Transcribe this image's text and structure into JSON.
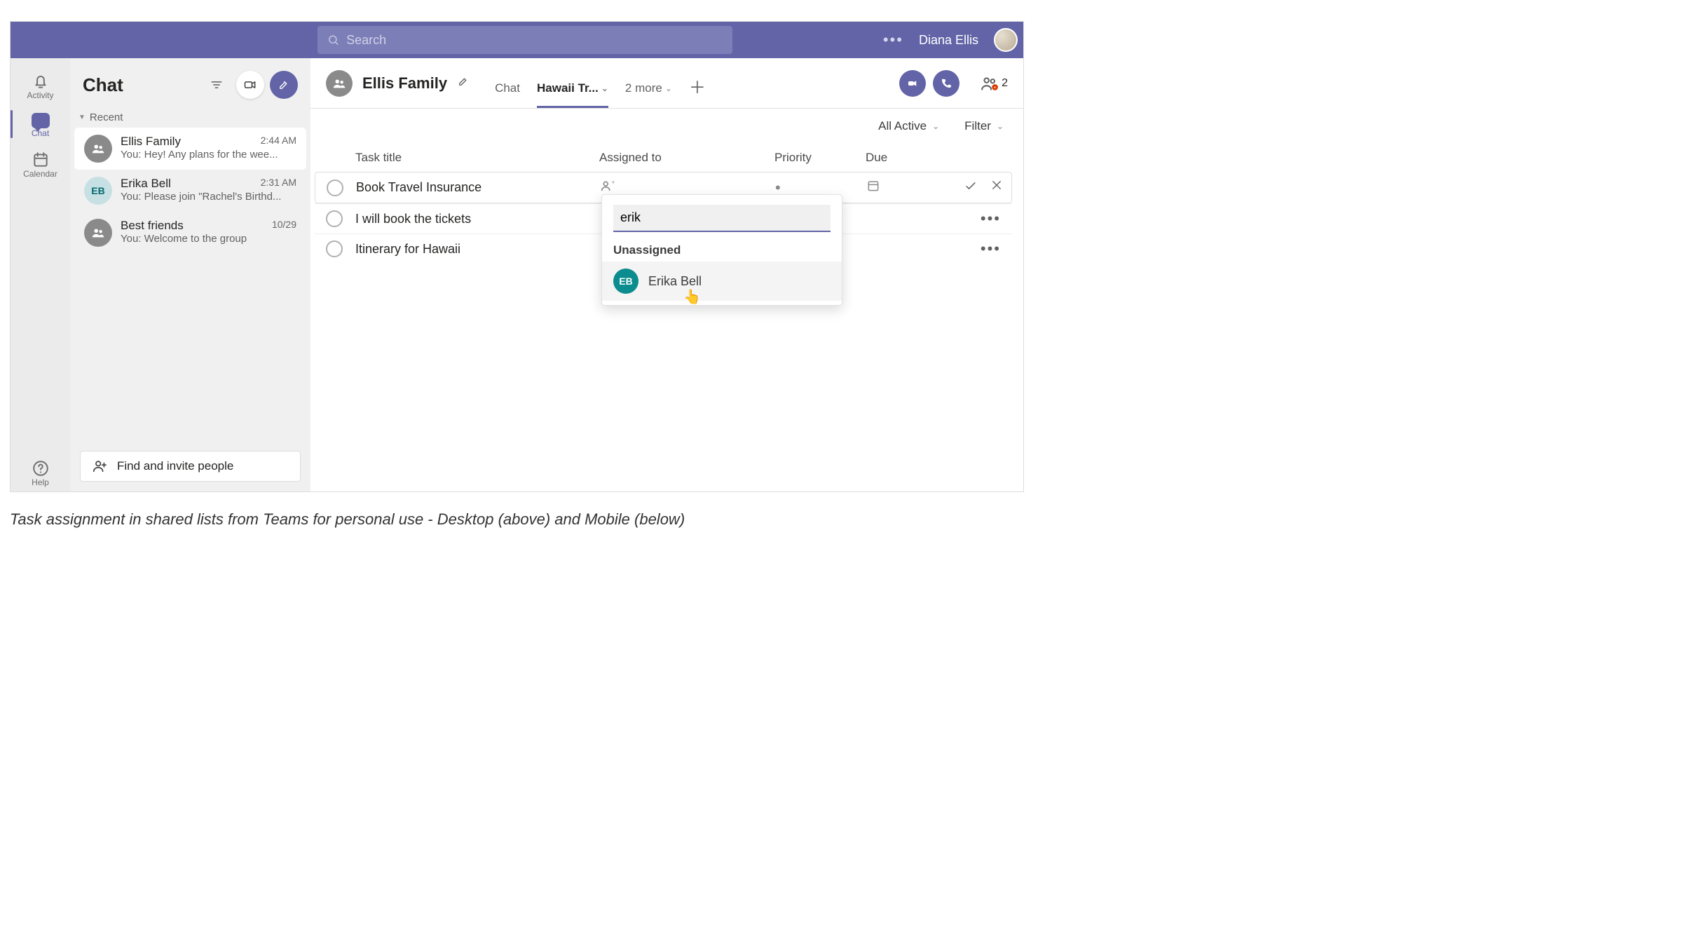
{
  "titlebar": {
    "search_placeholder": "Search",
    "user_name": "Diana Ellis"
  },
  "rail": {
    "activity": "Activity",
    "chat": "Chat",
    "calendar": "Calendar",
    "help": "Help"
  },
  "sidebar": {
    "title": "Chat",
    "section": "Recent",
    "items": [
      {
        "name": "Ellis Family",
        "time": "2:44 AM",
        "preview": "You: Hey! Any plans for the wee...",
        "avatar_type": "group",
        "initials": ""
      },
      {
        "name": "Erika Bell",
        "time": "2:31 AM",
        "preview": "You: Please join \"Rachel's Birthd...",
        "avatar_type": "eb",
        "initials": "EB"
      },
      {
        "name": "Best friends",
        "time": "10/29",
        "preview": "You: Welcome to the group",
        "avatar_type": "group",
        "initials": ""
      }
    ],
    "invite": "Find and invite people"
  },
  "chat_header": {
    "title": "Ellis Family",
    "tabs": {
      "chat": "Chat",
      "active": "Hawaii Tr...",
      "more": "2 more"
    },
    "people_count": "2"
  },
  "filters": {
    "view": "All Active",
    "filter": "Filter"
  },
  "columns": {
    "title": "Task title",
    "assigned": "Assigned to",
    "priority": "Priority",
    "due": "Due"
  },
  "tasks": [
    {
      "title": "Book Travel Insurance",
      "selected": true
    },
    {
      "title": "I will book the tickets",
      "selected": false
    },
    {
      "title": "Itinerary for Hawaii",
      "selected": false
    }
  ],
  "assign_popover": {
    "input_value": "erik",
    "group_label": "Unassigned",
    "option": {
      "initials": "EB",
      "name": "Erika Bell"
    }
  },
  "caption": "Task assignment in shared lists from Teams for personal use - Desktop (above) and Mobile (below)"
}
